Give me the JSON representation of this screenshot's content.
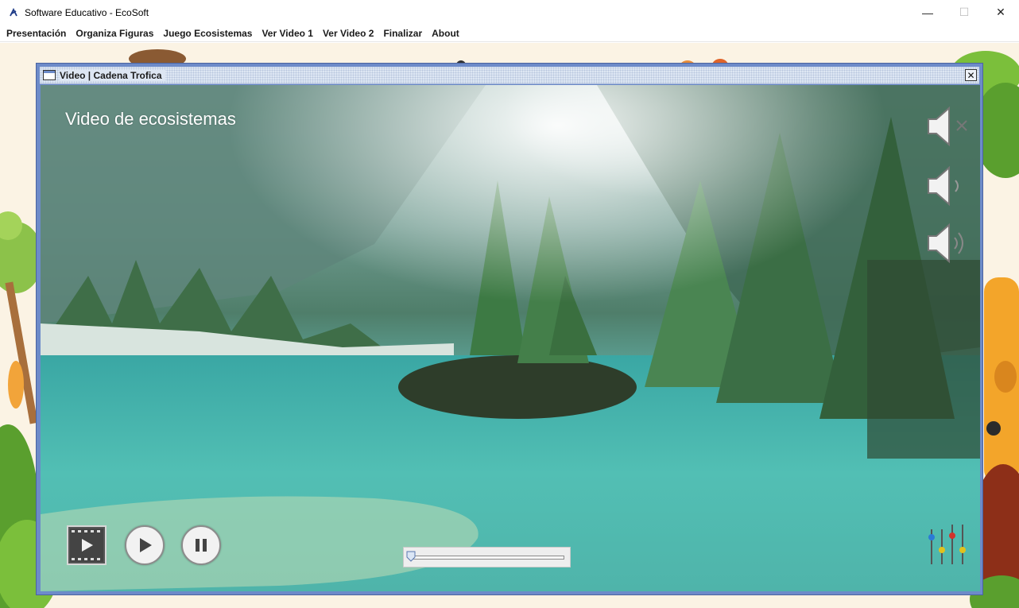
{
  "window": {
    "title": "Software Educativo - EcoSoft",
    "controls": {
      "minimize": "—",
      "maximize": "☐",
      "close": "✕"
    }
  },
  "menu": {
    "items": [
      "Presentación",
      "Organiza Figuras",
      "Juego Ecosistemas",
      "Ver Video 1",
      "Ver Video 2",
      "Finalizar",
      "About"
    ]
  },
  "internal_frame": {
    "title": "Video | Cadena Trofica",
    "close": "✕"
  },
  "video": {
    "caption": "Video de ecosistemas",
    "progress": 0.0
  },
  "icons": {
    "app": "ecosoft-app-icon",
    "film": "film-strip-icon",
    "play": "play-icon",
    "pause": "pause-icon",
    "mute": "speaker-mute-icon",
    "volume_low": "speaker-low-icon",
    "volume_high": "speaker-high-icon",
    "equalizer": "equalizer-icon"
  }
}
